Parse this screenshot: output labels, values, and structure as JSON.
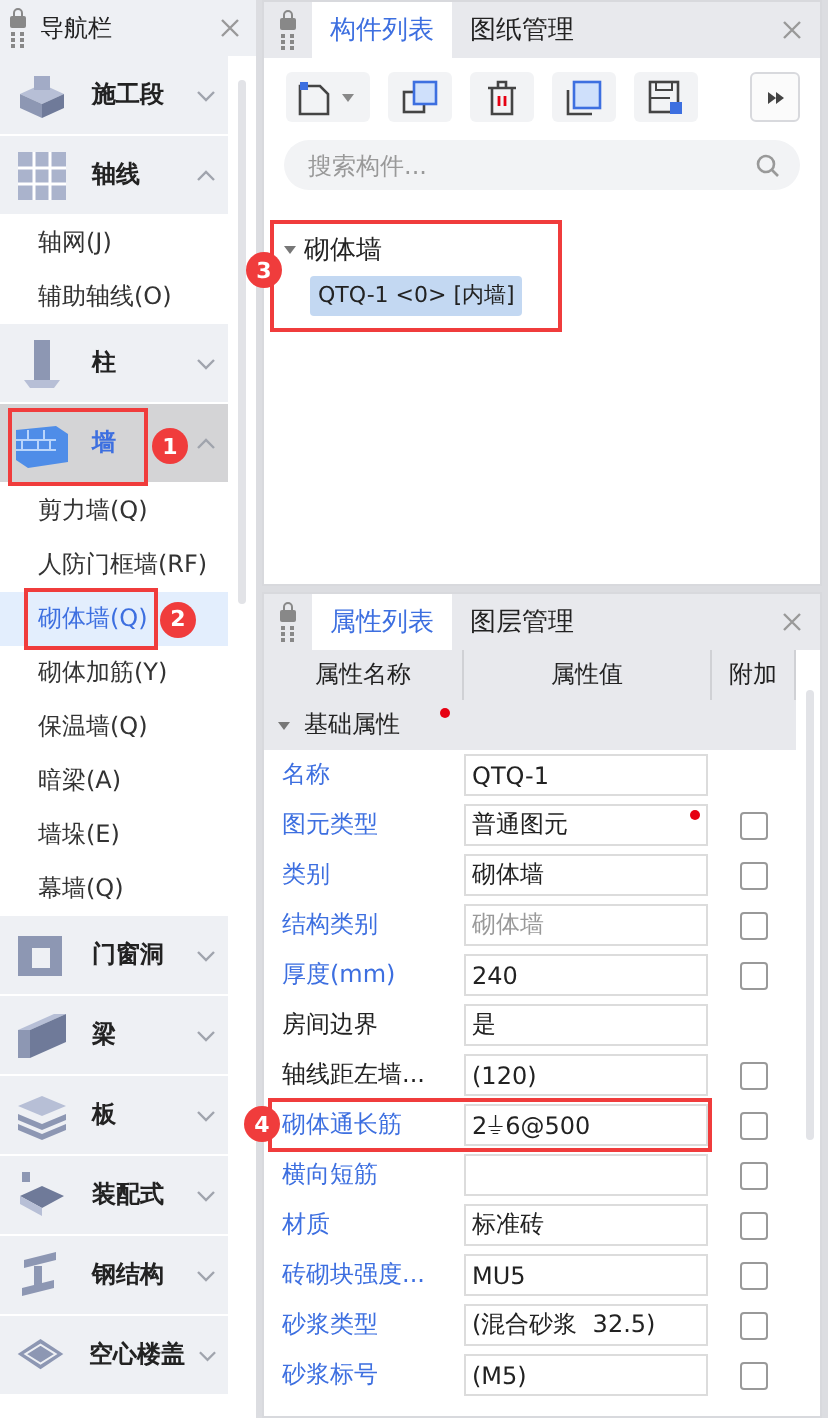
{
  "nav": {
    "title": "导航栏",
    "groups": [
      {
        "label": "施工段",
        "expanded": false,
        "selected": false
      },
      {
        "label": "轴线",
        "expanded": true,
        "selected": false,
        "items": [
          {
            "label": "轴网(J)",
            "selected": false
          },
          {
            "label": "辅助轴线(O)",
            "selected": false
          }
        ]
      },
      {
        "label": "柱",
        "expanded": false,
        "selected": false
      },
      {
        "label": "墙",
        "expanded": true,
        "selected": true,
        "highlighted": true,
        "badge": "1",
        "items": [
          {
            "label": "剪力墙(Q)",
            "selected": false
          },
          {
            "label": "人防门框墙(RF)",
            "selected": false
          },
          {
            "label": "砌体墙(Q)",
            "selected": true,
            "highlighted": true,
            "badge": "2"
          },
          {
            "label": "砌体加筋(Y)",
            "selected": false
          },
          {
            "label": "保温墙(Q)",
            "selected": false
          },
          {
            "label": "暗梁(A)",
            "selected": false
          },
          {
            "label": "墙垛(E)",
            "selected": false
          },
          {
            "label": "幕墙(Q)",
            "selected": false
          }
        ]
      },
      {
        "label": "门窗洞",
        "expanded": false,
        "selected": false
      },
      {
        "label": "梁",
        "expanded": false,
        "selected": false
      },
      {
        "label": "板",
        "expanded": false,
        "selected": false
      },
      {
        "label": "装配式",
        "expanded": false,
        "selected": false
      },
      {
        "label": "钢结构",
        "expanded": false,
        "selected": false
      },
      {
        "label": "空心楼盖",
        "expanded": false,
        "selected": false
      }
    ]
  },
  "component_panel": {
    "tabs": [
      {
        "label": "构件列表",
        "selected": true
      },
      {
        "label": "图纸管理",
        "selected": false
      }
    ],
    "search": {
      "placeholder": "搜索构件..."
    },
    "tree": {
      "highlighted": true,
      "badge": "3",
      "label": "砌体墙",
      "expanded": true,
      "children": [
        {
          "label": "QTQ-1 <0> [内墙]",
          "selected": true
        }
      ]
    }
  },
  "property_panel": {
    "tabs": [
      {
        "label": "属性列表",
        "selected": true
      },
      {
        "label": "图层管理",
        "selected": false
      }
    ],
    "columns": [
      "属性名称",
      "属性值",
      "附加"
    ],
    "group": {
      "label": "基础属性",
      "expanded": true,
      "modified": true
    },
    "rows": [
      {
        "name": "名称",
        "value": "QTQ-1",
        "linked": true,
        "disabled": false
      },
      {
        "name": "图元类型",
        "value": "普通图元",
        "linked": true,
        "disabled": false,
        "modified": true,
        "checked": false
      },
      {
        "name": "类别",
        "value": "砌体墙",
        "linked": true,
        "disabled": false,
        "checked": false
      },
      {
        "name": "结构类别",
        "value": "砌体墙",
        "linked": true,
        "disabled": true,
        "checked": false
      },
      {
        "name": "厚度(mm)",
        "value": "240",
        "linked": true,
        "disabled": false,
        "checked": false
      },
      {
        "name": "房间边界",
        "value": "是",
        "linked": false,
        "disabled": false
      },
      {
        "name": "轴线距左墙...",
        "value": "(120)",
        "linked": false,
        "disabled": false,
        "checked": false
      },
      {
        "name": "砌体通长筋",
        "value": "2⏚6@500",
        "linked": true,
        "disabled": false,
        "checked": false,
        "highlighted": true,
        "badge": "4"
      },
      {
        "name": "横向短筋",
        "linked": true,
        "disabled": false,
        "checked": false
      },
      {
        "name": "材质",
        "value": "标准砖",
        "linked": true,
        "disabled": false,
        "checked": false
      },
      {
        "name": "砖砌块强度...",
        "value": "MU5",
        "linked": true,
        "disabled": false,
        "checked": false
      },
      {
        "name": "砂浆类型",
        "value": "(混合砂浆  32.5)",
        "linked": true,
        "disabled": false,
        "checked": false
      },
      {
        "name": "砂浆标号",
        "value": "(M5)",
        "linked": true,
        "disabled": false,
        "checked": false
      }
    ]
  }
}
